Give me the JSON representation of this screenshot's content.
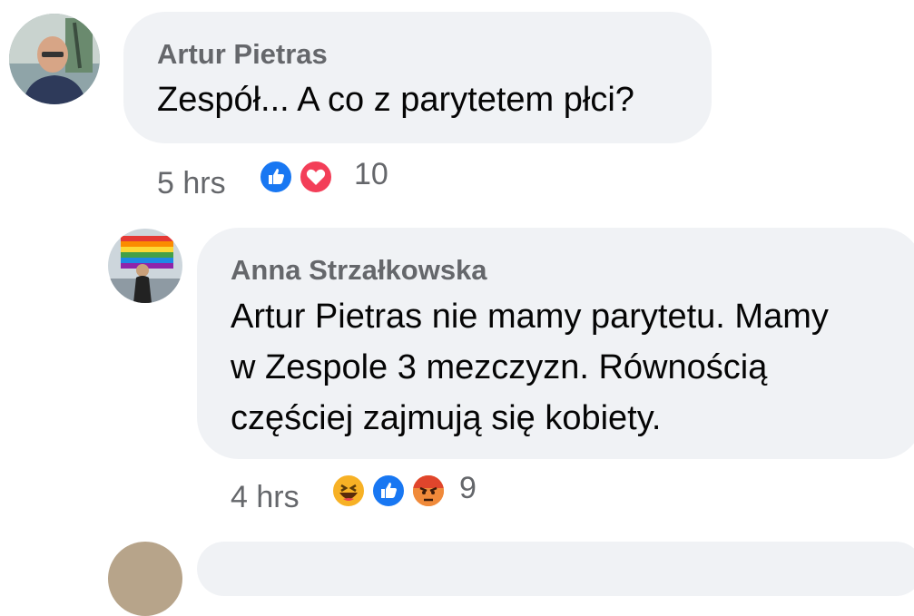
{
  "comments": [
    {
      "author": "Artur Pietras",
      "text": "Zespół... A co z parytetem płci?",
      "time": "5 hrs",
      "reaction_count": "10",
      "reactions": [
        "like-icon",
        "love-icon"
      ]
    },
    {
      "author": "Anna Strzałkowska",
      "text_lines": [
        "Artur Pietras nie mamy parytetu. Mamy",
        "w Zespole 3 mezczyzn. Równością",
        "częściej zajmują się kobiety."
      ],
      "time": "4 hrs",
      "reaction_count": "9",
      "reactions": [
        "haha-icon",
        "like-icon",
        "angry-icon"
      ]
    }
  ],
  "colors": {
    "bubble": "#f0f2f5",
    "secondary_text": "#65676b",
    "like_blue": "#1877f2",
    "love_red": "#f33e58",
    "angry_orange": "#e9710f",
    "haha_yellow": "#f7b125"
  }
}
